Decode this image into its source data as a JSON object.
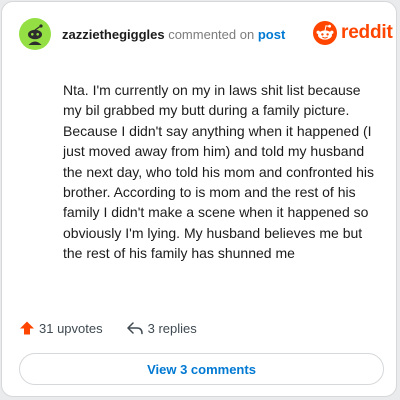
{
  "comment": {
    "username": "zazziethegiggles",
    "action_text": "commented on",
    "post_link": "post",
    "avatar_icon": "snoo-avatar-icon",
    "body": "Nta. I'm currently on my in laws shit list because my bil grabbed my butt during a family picture. Because I didn't say anything when it happened (I just moved away from him) and told my husband the next day, who told his mom and confronted his brother. According to is mom and the rest of his family I didn't make a scene when it happened so obviously I'm lying. My husband believes me but the rest of his family has shunned me"
  },
  "brand": {
    "name": "reddit",
    "icon": "reddit-snoo-icon",
    "color": "#ff4500"
  },
  "actions": {
    "upvotes_label": "31 upvotes",
    "upvote_icon": "upvote-arrow-icon",
    "upvote_color": "#ff4500",
    "replies_label": "3 replies",
    "reply_icon": "reply-arrow-icon"
  },
  "view_comments_label": "View 3 comments",
  "colors": {
    "link": "#0079d3",
    "avatar_bg": "#94e044",
    "muted_text": "#7c7c7c"
  }
}
